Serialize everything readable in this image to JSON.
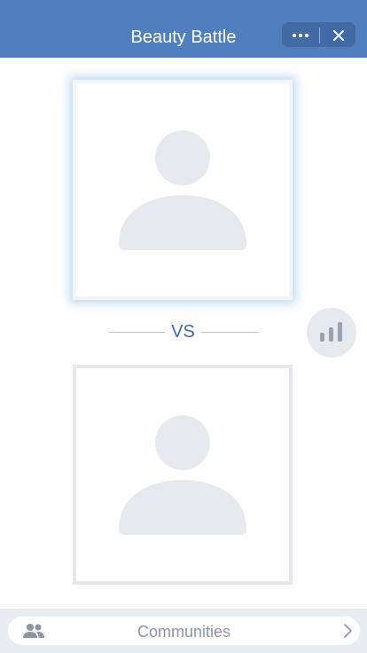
{
  "header": {
    "title": "Beauty Battle",
    "more_icon": "more-dots-icon",
    "close_icon": "close-icon",
    "background": "#4f7fbf"
  },
  "battle": {
    "top_photo": {
      "icon": "avatar-placeholder-icon",
      "selected": true
    },
    "bottom_photo": {
      "icon": "avatar-placeholder-icon",
      "selected": false
    },
    "vs_label": "VS",
    "rank_icon": "bar-chart-icon"
  },
  "bottom_bar": {
    "label": "Communities",
    "left_icon": "people-icon",
    "right_icon": "chevron-right-icon"
  },
  "colors": {
    "accent": "#3e6aa4",
    "placeholder": "#e6e9ee",
    "frame_border": "#e4e8ed"
  }
}
